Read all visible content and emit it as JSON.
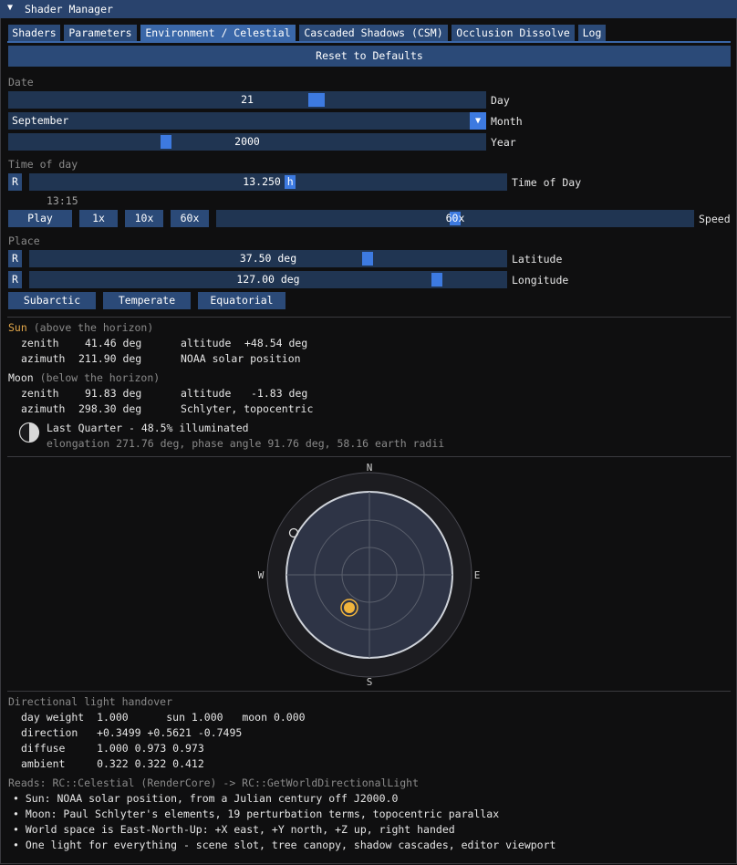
{
  "window": {
    "title": "Shader Manager"
  },
  "tabs": [
    {
      "label": "Shaders"
    },
    {
      "label": "Parameters"
    },
    {
      "label": "Environment / Celestial"
    },
    {
      "label": "Cascaded Shadows (CSM)"
    },
    {
      "label": "Occlusion Dissolve"
    },
    {
      "label": "Log"
    }
  ],
  "reset_label": "Reset to Defaults",
  "date": {
    "section": "Date",
    "day_value": "21",
    "day_label": "Day",
    "day_fraction": 0.645,
    "month_value": "September",
    "month_label": "Month",
    "year_value": "2000",
    "year_label": "Year",
    "year_fraction": 0.33
  },
  "time": {
    "section": "Time of day",
    "reset": "R",
    "value": "13.250 h",
    "label": "Time of Day",
    "fraction": 0.545,
    "clock": "13:15",
    "play": "Play",
    "speed_1": "1x",
    "speed_10": "10x",
    "speed_60": "60x",
    "speed_value": "60x",
    "speed_label": "Speed",
    "speed_fraction": 0.5
  },
  "place": {
    "section": "Place",
    "reset": "R",
    "lat_value": "37.50 deg",
    "lat_label": "Latitude",
    "lat_fraction": 0.708,
    "lon_value": "127.00 deg",
    "lon_label": "Longitude",
    "lon_fraction": 0.853,
    "preset_1": "Subarctic",
    "preset_2": "Temperate",
    "preset_3": "Equatorial"
  },
  "sun": {
    "name": "Sun",
    "state": "(above the horizon)",
    "zenith_label": "zenith",
    "zenith": "41.46 deg",
    "altitude_label": "altitude",
    "altitude": "+48.54 deg",
    "azimuth_label": "azimuth",
    "azimuth": "211.90 deg",
    "model": "NOAA solar position"
  },
  "moon": {
    "name": "Moon",
    "state": "(below the horizon)",
    "zenith_label": "zenith",
    "zenith": "91.83 deg",
    "altitude_label": "altitude",
    "altitude": "-1.83 deg",
    "azimuth_label": "azimuth",
    "azimuth": "298.30 deg",
    "model": "Schlyter, topocentric",
    "phase": "Last Quarter - 48.5% illuminated",
    "detail": "elongation 271.76 deg, phase angle 91.76 deg, 58.16 earth radii"
  },
  "compass": {
    "n": "N",
    "s": "S",
    "e": "E",
    "w": "W"
  },
  "handover": {
    "section": "Directional light handover",
    "row1": "day weight  1.000      sun 1.000   moon 0.000",
    "row2": "direction   +0.3499 +0.5621 -0.7495",
    "row3": "diffuse     1.000 0.973 0.973",
    "row4": "ambient     0.322 0.322 0.412"
  },
  "reads": "Reads: RC::Celestial (RenderCore) -> RC::GetWorldDirectionalLight",
  "notes": [
    "Sun: NOAA solar position, from a Julian century off J2000.0",
    "Moon: Paul Schlyter's elements, 19 perturbation terms, topocentric parallax",
    "World space is East-North-Up: +X east, +Y north, +Z up, right handed",
    "One light for everything - scene slot, tree canopy, shadow cascades, editor viewport"
  ],
  "colors": {
    "accent": "#3d7ae0",
    "sun": "#f0b43c",
    "title_bar": "#29436d"
  },
  "icons": {
    "collapse": "triangle-down-icon",
    "combo": "triangle-down-icon",
    "moon_phase": "moon-phase-icon"
  }
}
